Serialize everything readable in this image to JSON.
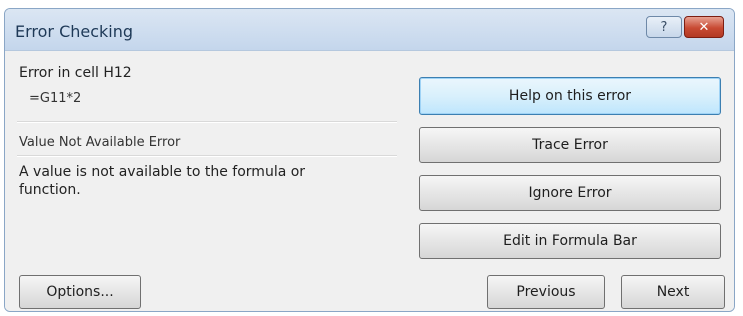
{
  "window": {
    "title": "Error Checking",
    "help_glyph": "?",
    "close_glyph": "✕"
  },
  "error": {
    "cell_label": "Error in cell H12",
    "formula": "=G11*2",
    "name": "Value Not Available Error",
    "description": "A value is not available to the formula or function."
  },
  "buttons": {
    "help": "Help on this error",
    "trace": "Trace Error",
    "ignore": "Ignore Error",
    "edit": "Edit in Formula Bar",
    "options": "Options...",
    "previous": "Previous",
    "next": "Next"
  },
  "colors": {
    "titlebar": "#c4d6ec",
    "close_button": "#c84a33",
    "dialog_background": "#f0f0f0",
    "default_button_border": "#3c7fb1"
  }
}
